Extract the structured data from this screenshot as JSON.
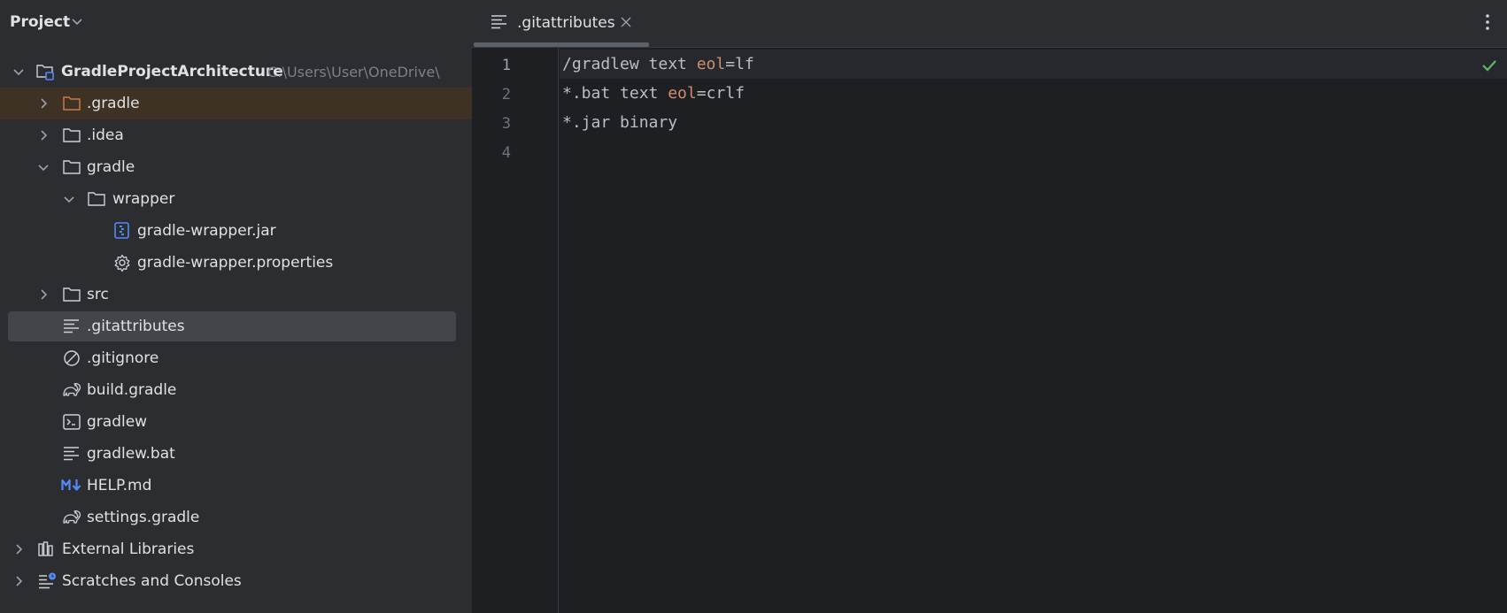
{
  "panel": {
    "title": "Project"
  },
  "tree": {
    "root": {
      "label": "GradleProjectArchitecture",
      "path": "C:\\Users\\User\\OneDrive\\"
    },
    "items": [
      {
        "label": ".gradle"
      },
      {
        "label": ".idea"
      },
      {
        "label": "gradle"
      },
      {
        "label": "wrapper"
      },
      {
        "label": "gradle-wrapper.jar"
      },
      {
        "label": "gradle-wrapper.properties"
      },
      {
        "label": "src"
      },
      {
        "label": ".gitattributes"
      },
      {
        "label": ".gitignore"
      },
      {
        "label": "build.gradle"
      },
      {
        "label": "gradlew"
      },
      {
        "label": "gradlew.bat"
      },
      {
        "label": "HELP.md"
      },
      {
        "label": "settings.gradle"
      },
      {
        "label": "External Libraries"
      },
      {
        "label": "Scratches and Consoles"
      }
    ]
  },
  "editor": {
    "tab_label": ".gitattributes",
    "line_numbers": [
      "1",
      "2",
      "3",
      "4"
    ],
    "lines": [
      {
        "pre": "/gradlew text ",
        "key": "eol",
        "post": "=lf"
      },
      {
        "pre": "*.bat text ",
        "key": "eol",
        "post": "=crlf"
      },
      {
        "pre": "*.jar binary",
        "key": "",
        "post": ""
      },
      {
        "pre": "",
        "key": "",
        "post": ""
      }
    ]
  },
  "colors": {
    "panel_bg": "#2b2d30",
    "editor_bg": "#1e1f22",
    "selection": "#43454a",
    "highlight_row": "#3d3223",
    "keyword": "#cf8e6d",
    "check": "#5fb865",
    "folder_orange": "#c9794a",
    "icon_blue": "#548af7"
  }
}
